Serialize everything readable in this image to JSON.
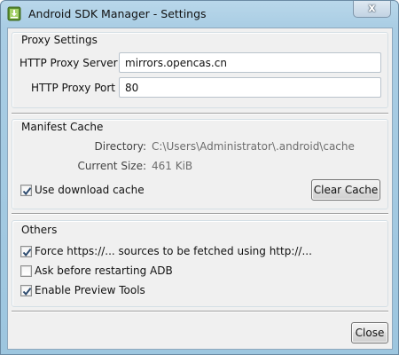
{
  "window": {
    "title": "Android SDK Manager - Settings",
    "app_icon": "download-arrow-icon",
    "close_glyph": "x"
  },
  "proxy": {
    "group_title": "Proxy Settings",
    "server_label": "HTTP Proxy Server",
    "server_value": "mirrors.opencas.cn",
    "port_label": "HTTP Proxy Port",
    "port_value": "80"
  },
  "manifest": {
    "group_title": "Manifest Cache",
    "directory_label": "Directory:",
    "directory_value": "C:\\Users\\Administrator\\.android\\cache",
    "size_label": "Current Size:",
    "size_value": "461 KiB",
    "use_cache_label": "Use download cache",
    "use_cache_checked": true,
    "clear_button": "Clear Cache"
  },
  "others": {
    "group_title": "Others",
    "force_http_label": "Force https://... sources to be fetched using http://...",
    "force_http_checked": true,
    "ask_restart_label": "Ask before restarting ADB",
    "ask_restart_checked": false,
    "preview_tools_label": "Enable Preview Tools",
    "preview_tools_checked": true
  },
  "footer": {
    "close_button": "Close"
  },
  "colors": {
    "window_frame": "#a9cde4",
    "dialog_background": "#f0f0f0",
    "checkmark": "#2c4a6e"
  }
}
